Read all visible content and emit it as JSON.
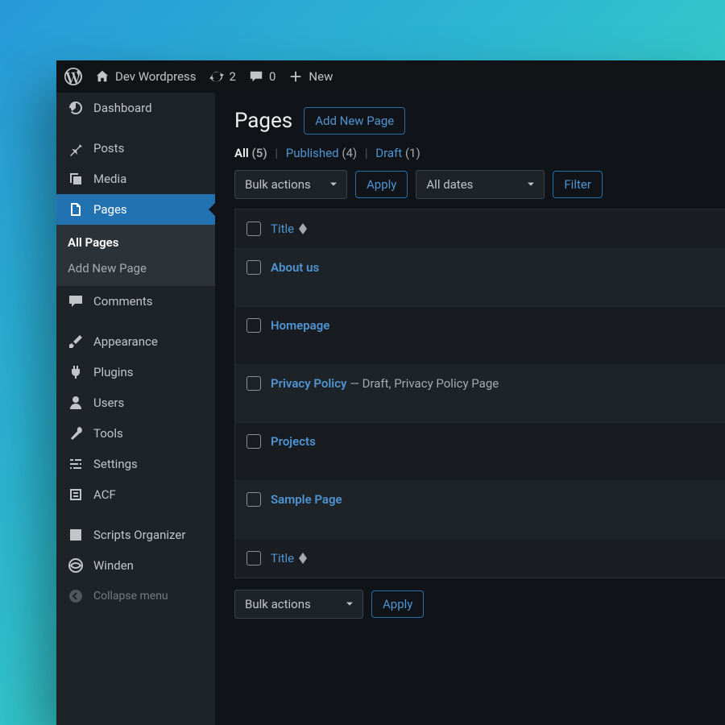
{
  "adminbar": {
    "site_name": "Dev Wordpress",
    "updates_count": "2",
    "comments_count": "0",
    "new_label": "New"
  },
  "sidebar": {
    "items": [
      {
        "id": "dashboard",
        "label": "Dashboard"
      },
      {
        "id": "posts",
        "label": "Posts"
      },
      {
        "id": "media",
        "label": "Media"
      },
      {
        "id": "pages",
        "label": "Pages",
        "current": true
      },
      {
        "id": "comments",
        "label": "Comments"
      },
      {
        "id": "appearance",
        "label": "Appearance"
      },
      {
        "id": "plugins",
        "label": "Plugins"
      },
      {
        "id": "users",
        "label": "Users"
      },
      {
        "id": "tools",
        "label": "Tools"
      },
      {
        "id": "settings",
        "label": "Settings"
      },
      {
        "id": "acf",
        "label": "ACF"
      },
      {
        "id": "scripts-organizer",
        "label": "Scripts Organizer"
      },
      {
        "id": "winden",
        "label": "Winden"
      }
    ],
    "submenu": {
      "all_pages": "All Pages",
      "add_new": "Add New Page"
    },
    "collapse_label": "Collapse menu"
  },
  "content": {
    "page_title": "Pages",
    "add_new_button": "Add New Page",
    "views": {
      "all": {
        "label": "All",
        "count": "(5)"
      },
      "published": {
        "label": "Published",
        "count": "(4)"
      },
      "draft": {
        "label": "Draft",
        "count": "(1)"
      }
    },
    "bulk_actions_label": "Bulk actions",
    "apply_label": "Apply",
    "all_dates_label": "All dates",
    "filter_label": "Filter",
    "column_title": "Title",
    "rows": [
      {
        "title": "About us",
        "suffix": ""
      },
      {
        "title": "Homepage",
        "suffix": ""
      },
      {
        "title": "Privacy Policy",
        "suffix": " — Draft, Privacy Policy Page"
      },
      {
        "title": "Projects",
        "suffix": ""
      },
      {
        "title": "Sample Page",
        "suffix": ""
      }
    ]
  }
}
